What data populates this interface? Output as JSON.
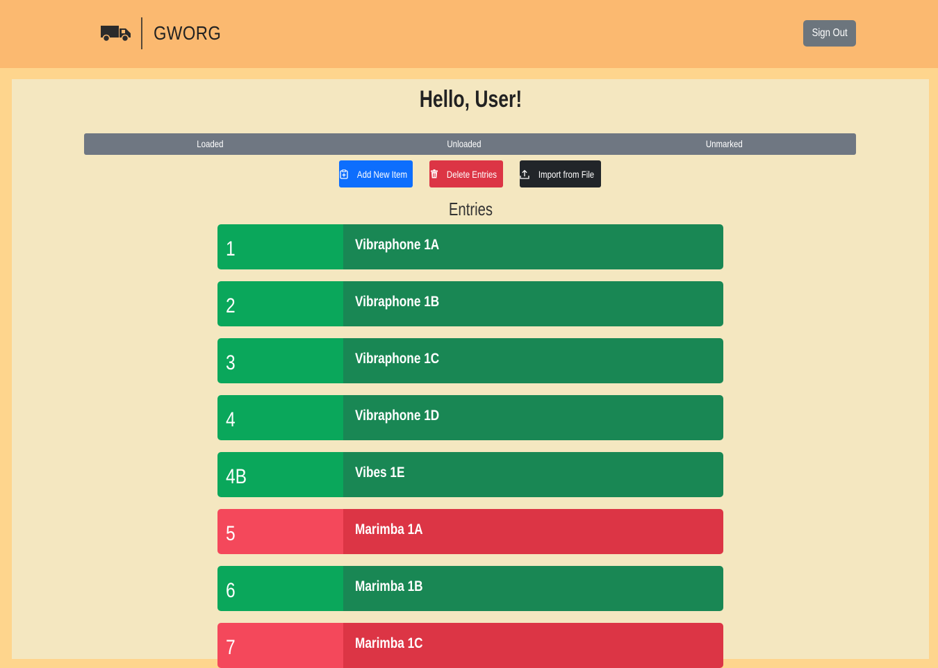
{
  "header": {
    "brand": "GWORG",
    "brand_icon": "truck-icon",
    "signout_label": "Sign Out"
  },
  "main": {
    "greeting": "Hello, User!",
    "status_bar": {
      "loaded": "Loaded",
      "unloaded": "Unloaded",
      "unmarked": "Unmarked"
    },
    "actions": {
      "add_label": "Add New Item",
      "delete_label": "Delete Entries",
      "import_label": "Import from File"
    },
    "entries_heading": "Entries",
    "entries": [
      {
        "number": "1",
        "name": "Vibraphone 1A",
        "status": "loaded"
      },
      {
        "number": "2",
        "name": "Vibraphone 1B",
        "status": "loaded"
      },
      {
        "number": "3",
        "name": "Vibraphone 1C",
        "status": "loaded"
      },
      {
        "number": "4",
        "name": "Vibraphone 1D",
        "status": "loaded"
      },
      {
        "number": "4B",
        "name": "Vibes 1E",
        "status": "loaded"
      },
      {
        "number": "5",
        "name": "Marimba 1A",
        "status": "unloaded"
      },
      {
        "number": "6",
        "name": "Marimba 1B",
        "status": "loaded"
      },
      {
        "number": "7",
        "name": "Marimba 1C",
        "status": "unloaded"
      }
    ]
  },
  "colors": {
    "page_bg": "#fed58d",
    "navbar_bg": "#fbb970",
    "content_bg": "#f4e7c0",
    "loaded_number": "#0aa75b",
    "loaded_name": "#198754",
    "unloaded_number": "#f4485b",
    "unloaded_name": "#dc3545"
  }
}
